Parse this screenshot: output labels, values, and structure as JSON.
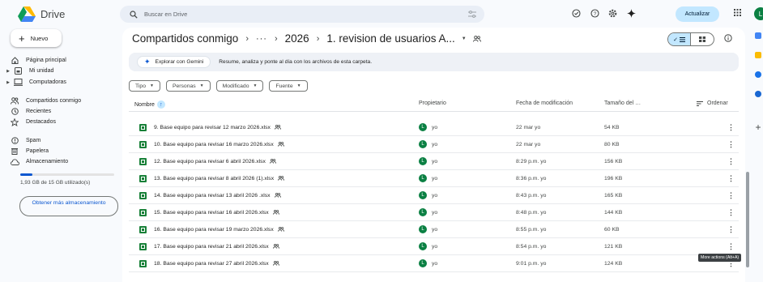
{
  "app": {
    "name": "Drive"
  },
  "search": {
    "placeholder": "Buscar en Drive"
  },
  "header": {
    "update_label": "Actualizar",
    "avatar_initial": "L"
  },
  "sidebar": {
    "new_label": "Nuevo",
    "items": [
      {
        "label": "Página principal",
        "icon": "home-icon"
      },
      {
        "label": "Mi unidad",
        "icon": "my-drive-icon"
      },
      {
        "label": "Computadoras",
        "icon": "computers-icon"
      },
      {
        "label": "Compartidos conmigo",
        "icon": "shared-icon"
      },
      {
        "label": "Recientes",
        "icon": "clock-icon"
      },
      {
        "label": "Destacados",
        "icon": "star-icon"
      },
      {
        "label": "Spam",
        "icon": "spam-icon"
      },
      {
        "label": "Papelera",
        "icon": "trash-icon"
      },
      {
        "label": "Almacenamiento",
        "icon": "cloud-icon"
      }
    ],
    "storage": {
      "text": "1,93 GB de 15 GB utilizado(s)",
      "used_fraction": 0.129
    },
    "get_storage_label": "Obtener más almacenamiento"
  },
  "breadcrumb": {
    "root": "Compartidos conmigo",
    "ellipsis": "···",
    "middle": "2026",
    "current": "1. revision de usuarios A..."
  },
  "gemini": {
    "button_label": "Explorar con Gemini",
    "text": "Resume, analiza y ponte al día con los archivos de esta carpeta."
  },
  "filters": [
    "Tipo",
    "Personas",
    "Modificado",
    "Fuente"
  ],
  "table": {
    "columns": {
      "name": "Nombre",
      "owner": "Propietario",
      "date": "Fecha de modificación",
      "size": "Tamaño del …",
      "sort": "Ordenar"
    },
    "rows": [
      {
        "name": "9. Base equipo para revisar 12 marzo 2026.xlsx",
        "owner": "yo",
        "date": "22 mar yo",
        "size": "54 KB"
      },
      {
        "name": "10. Base equipo para revisar 16 marzo 2026.xlsx",
        "owner": "yo",
        "date": "22 mar yo",
        "size": "80 KB"
      },
      {
        "name": "12. Base equipo para revisar 6 abril 2026.xlsx",
        "owner": "yo",
        "date": "8:29 p.m. yo",
        "size": "156 KB"
      },
      {
        "name": "13. Base equipo para revisar 8 abril 2026 (1).xlsx",
        "owner": "yo",
        "date": "8:36 p.m. yo",
        "size": "196 KB"
      },
      {
        "name": "14. Base equipo para revisar 13 abril 2026 .xlsx",
        "owner": "yo",
        "date": "8:43 p.m. yo",
        "size": "165 KB"
      },
      {
        "name": "15. Base equipo para revisar 16 abril 2026.xlsx",
        "owner": "yo",
        "date": "8:48 p.m. yo",
        "size": "144 KB"
      },
      {
        "name": "16. Base equipo para revisar 19 marzo 2026.xlsx",
        "owner": "yo",
        "date": "8:55 p.m. yo",
        "size": "60 KB"
      },
      {
        "name": "17. Base equipo para revisar 21 abril 2026.xlsx",
        "owner": "yo",
        "date": "8:54 p.m. yo",
        "size": "121 KB"
      },
      {
        "name": "18. Base equipo para revisar 27 abril 2026.xlsx",
        "owner": "yo",
        "date": "9:01 p.m. yo",
        "size": "124 KB"
      }
    ]
  },
  "tooltip": "More actions (Alt+A)",
  "colors": {
    "accent": "#0b57d0",
    "selected": "#c2e7ff",
    "excel": "#188038",
    "avatar": "#0b8043"
  }
}
